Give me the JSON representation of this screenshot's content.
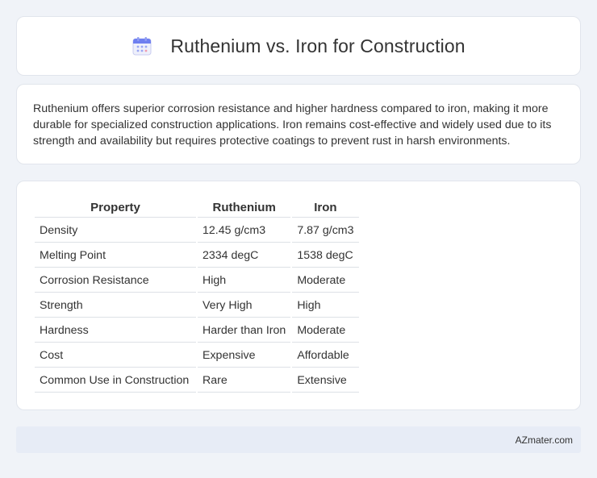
{
  "header": {
    "icon": "calendar-icon",
    "title": "Ruthenium vs. Iron for Construction"
  },
  "summary": {
    "text": "Ruthenium offers superior corrosion resistance and higher hardness compared to iron, making it more durable for specialized construction applications. Iron remains cost-effective and widely used due to its strength and availability but requires protective coatings to prevent rust in harsh environments."
  },
  "table": {
    "headers": [
      "Property",
      "Ruthenium",
      "Iron"
    ],
    "rows": [
      [
        "Density",
        "12.45 g/cm3",
        "7.87 g/cm3"
      ],
      [
        "Melting Point",
        "2334 degC",
        "1538 degC"
      ],
      [
        "Corrosion Resistance",
        "High",
        "Moderate"
      ],
      [
        "Strength",
        "Very High",
        "High"
      ],
      [
        "Hardness",
        "Harder than Iron",
        "Moderate"
      ],
      [
        "Cost",
        "Expensive",
        "Affordable"
      ],
      [
        "Common Use in Construction",
        "Rare",
        "Extensive"
      ]
    ]
  },
  "footer": {
    "text": "AZmater.com"
  },
  "colors": {
    "background": "#f0f3f8",
    "card": "#ffffff",
    "footer_bar": "#e7ecf6",
    "icon_accent": "#6e7ff0"
  }
}
